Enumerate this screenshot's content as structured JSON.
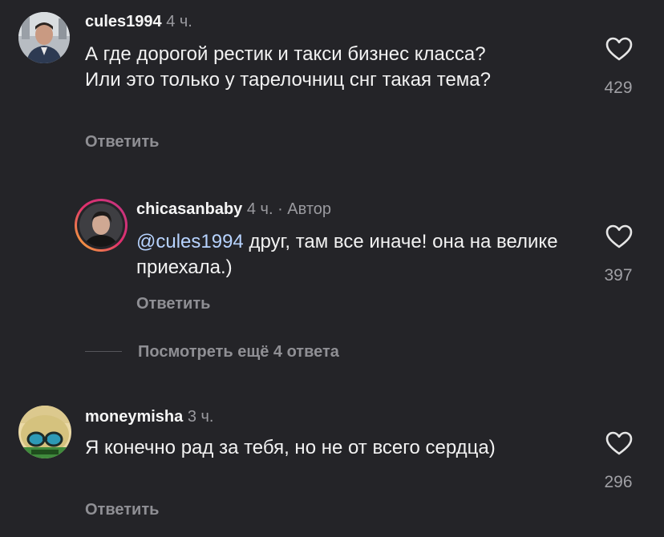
{
  "comments": [
    {
      "username": "cules1994",
      "time": "4 ч.",
      "text": "А где дорогой рестик и такси бизнес класса? Или это только у тарелочниц снг такая тема?",
      "reply_label": "Ответить",
      "likes": "429"
    },
    {
      "username": "chicasanbaby",
      "time": "4 ч. · Автор",
      "mention": "@cules1994",
      "text": " друг, там все иначе! она на велике приехала.)",
      "reply_label": "Ответить",
      "likes": "397"
    },
    {
      "username": "moneymisha",
      "time": "3 ч.",
      "text": "Я конечно рад за тебя, но не от всего сердца)",
      "reply_label": "Ответить",
      "likes": "296"
    }
  ],
  "more_replies": "Посмотреть ещё 4 ответа",
  "colors": {
    "background": "#242428",
    "mention": "#b7d3ff",
    "secondary": "#8f8f94",
    "story_ring_start": "#f7b733",
    "story_ring_end": "#d62976"
  },
  "icons": [
    "heart-outline-icon"
  ]
}
